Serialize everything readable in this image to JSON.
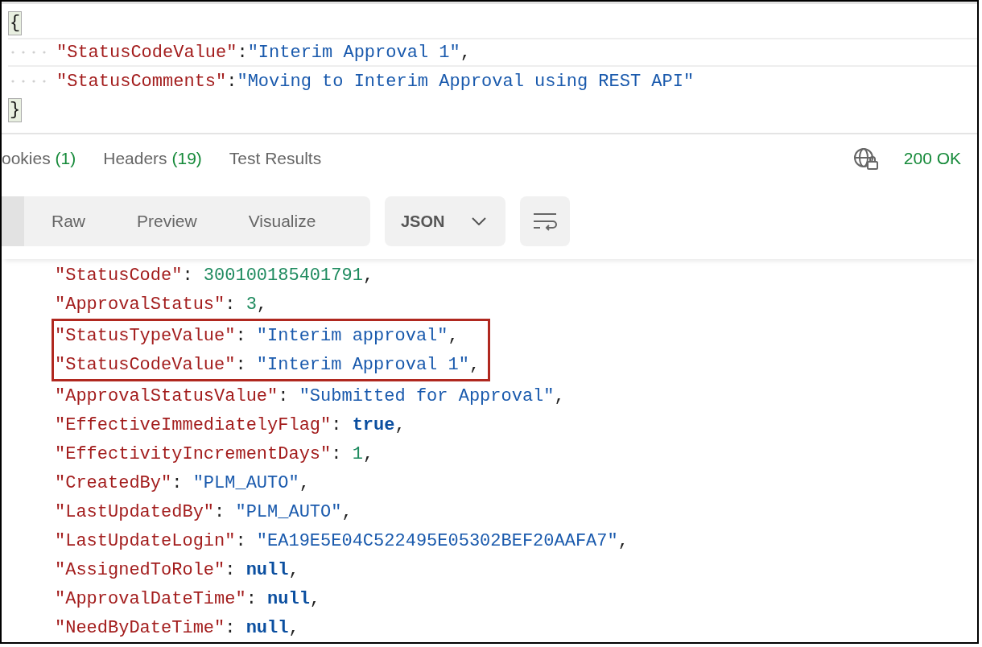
{
  "request_body": {
    "open_brace": "{",
    "close_brace": "}",
    "lines": [
      {
        "key": "\"StatusCodeValue\"",
        "sep": ":",
        "value": "\"Interim Approval 1\"",
        "trail": ",",
        "current": true
      },
      {
        "key": "\"StatusComments\"",
        "sep": ":",
        "value": "\"Moving to Interim Approval using REST API\"",
        "current": false
      }
    ]
  },
  "response_tabs": [
    {
      "label": "ookies",
      "count": "(1)"
    },
    {
      "label": "Headers",
      "count": "(19)"
    },
    {
      "label": "Test Results"
    }
  ],
  "status": {
    "code": "200 OK"
  },
  "view_modes": [
    "Raw",
    "Preview",
    "Visualize"
  ],
  "format": {
    "value": "JSON"
  },
  "response_lines": [
    {
      "key": "\"StatusCode\"",
      "sep": ": ",
      "value": "300100185401791",
      "trail": ",",
      "kind": "number",
      "highlighted": false
    },
    {
      "key": "\"ApprovalStatus\"",
      "sep": ": ",
      "value": "3",
      "trail": ",",
      "kind": "number",
      "highlighted": false
    },
    {
      "key": "\"StatusTypeValue\"",
      "sep": ": ",
      "value": "\"Interim approval\"",
      "trail": ",",
      "kind": "string",
      "highlighted": true
    },
    {
      "key": "\"StatusCodeValue\"",
      "sep": ": ",
      "value": "\"Interim Approval 1\"",
      "trail": ",",
      "kind": "string",
      "highlighted": true
    },
    {
      "key": "\"ApprovalStatusValue\"",
      "sep": ": ",
      "value": "\"Submitted for Approval\"",
      "trail": ",",
      "kind": "string",
      "highlighted": false
    },
    {
      "key": "\"EffectiveImmediatelyFlag\"",
      "sep": ": ",
      "value": "true",
      "trail": ",",
      "kind": "keyword",
      "highlighted": false
    },
    {
      "key": "\"EffectivityIncrementDays\"",
      "sep": ": ",
      "value": "1",
      "trail": ",",
      "kind": "number",
      "highlighted": false
    },
    {
      "key": "\"CreatedBy\"",
      "sep": ": ",
      "value": "\"PLM_AUTO\"",
      "trail": ",",
      "kind": "string",
      "highlighted": false
    },
    {
      "key": "\"LastUpdatedBy\"",
      "sep": ": ",
      "value": "\"PLM_AUTO\"",
      "trail": ",",
      "kind": "string",
      "highlighted": false
    },
    {
      "key": "\"LastUpdateLogin\"",
      "sep": ": ",
      "value": "\"EA19E5E04C522495E05302BEF20AAFA7\"",
      "trail": ",",
      "kind": "string",
      "highlighted": false
    },
    {
      "key": "\"AssignedToRole\"",
      "sep": ": ",
      "value": "null",
      "trail": ",",
      "kind": "keyword",
      "highlighted": false
    },
    {
      "key": "\"ApprovalDateTime\"",
      "sep": ": ",
      "value": "null",
      "trail": ",",
      "kind": "keyword",
      "highlighted": false
    },
    {
      "key": "\"NeedByDateTime\"",
      "sep": ": ",
      "value": "null",
      "trail": ",",
      "kind": "keyword",
      "highlighted": false
    }
  ]
}
